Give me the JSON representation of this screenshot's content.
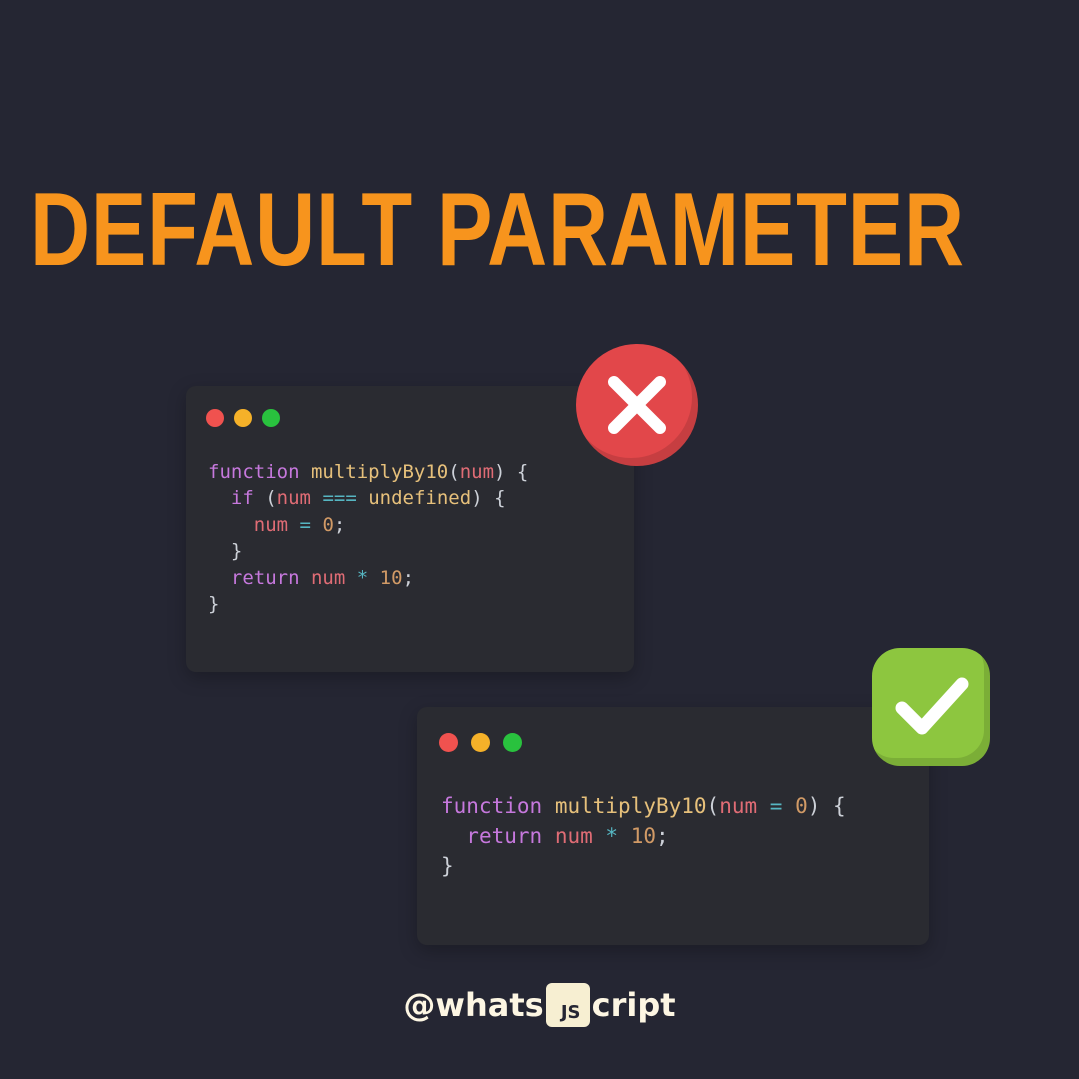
{
  "title": "DEFAULT PARAMETER",
  "windows": [
    {
      "status": "incorrect",
      "code_lines": [
        [
          [
            "kw",
            "function"
          ],
          [
            "punc",
            " "
          ],
          [
            "fn",
            "multiplyBy10"
          ],
          [
            "punc",
            "("
          ],
          [
            "var",
            "num"
          ],
          [
            "punc",
            ") {"
          ]
        ],
        [
          [
            "punc",
            "  "
          ],
          [
            "kw",
            "if"
          ],
          [
            "punc",
            " ("
          ],
          [
            "var",
            "num"
          ],
          [
            "punc",
            " "
          ],
          [
            "op",
            "==="
          ],
          [
            "punc",
            " "
          ],
          [
            "fn",
            "undefined"
          ],
          [
            "punc",
            ") {"
          ]
        ],
        [
          [
            "punc",
            "    "
          ],
          [
            "var",
            "num"
          ],
          [
            "punc",
            " "
          ],
          [
            "op",
            "="
          ],
          [
            "punc",
            " "
          ],
          [
            "num",
            "0"
          ],
          [
            "punc",
            ";"
          ]
        ],
        [
          [
            "punc",
            "  }"
          ]
        ],
        [
          [
            "punc",
            "  "
          ],
          [
            "kw",
            "return"
          ],
          [
            "punc",
            " "
          ],
          [
            "var",
            "num"
          ],
          [
            "punc",
            " "
          ],
          [
            "op",
            "*"
          ],
          [
            "punc",
            " "
          ],
          [
            "num",
            "10"
          ],
          [
            "punc",
            ";"
          ]
        ],
        [
          [
            "punc",
            "}"
          ]
        ]
      ]
    },
    {
      "status": "correct",
      "code_lines": [
        [
          [
            "kw",
            "function"
          ],
          [
            "punc",
            " "
          ],
          [
            "fn",
            "multiplyBy10"
          ],
          [
            "punc",
            "("
          ],
          [
            "var",
            "num"
          ],
          [
            "punc",
            " "
          ],
          [
            "op",
            "="
          ],
          [
            "punc",
            " "
          ],
          [
            "num",
            "0"
          ],
          [
            "punc",
            ") {"
          ]
        ],
        [
          [
            "punc",
            "  "
          ],
          [
            "kw",
            "return"
          ],
          [
            "punc",
            " "
          ],
          [
            "var",
            "num"
          ],
          [
            "punc",
            " "
          ],
          [
            "op",
            "*"
          ],
          [
            "punc",
            " "
          ],
          [
            "num",
            "10"
          ],
          [
            "punc",
            ";"
          ]
        ],
        [
          [
            "punc",
            "}"
          ]
        ]
      ]
    }
  ],
  "icons": {
    "incorrect": "close-icon",
    "correct": "checkmark-icon"
  },
  "handle": {
    "prefix": "@whats",
    "logo": "JS",
    "suffix": "cript"
  },
  "colors": {
    "background": "#252633",
    "title": "#f7941d",
    "window": "#2a2b31",
    "dot_red": "#f0524f",
    "dot_yellow": "#f5b129",
    "dot_green": "#29c23e",
    "badge_incorrect": "#e2474a",
    "badge_correct": "#8dc63f"
  }
}
